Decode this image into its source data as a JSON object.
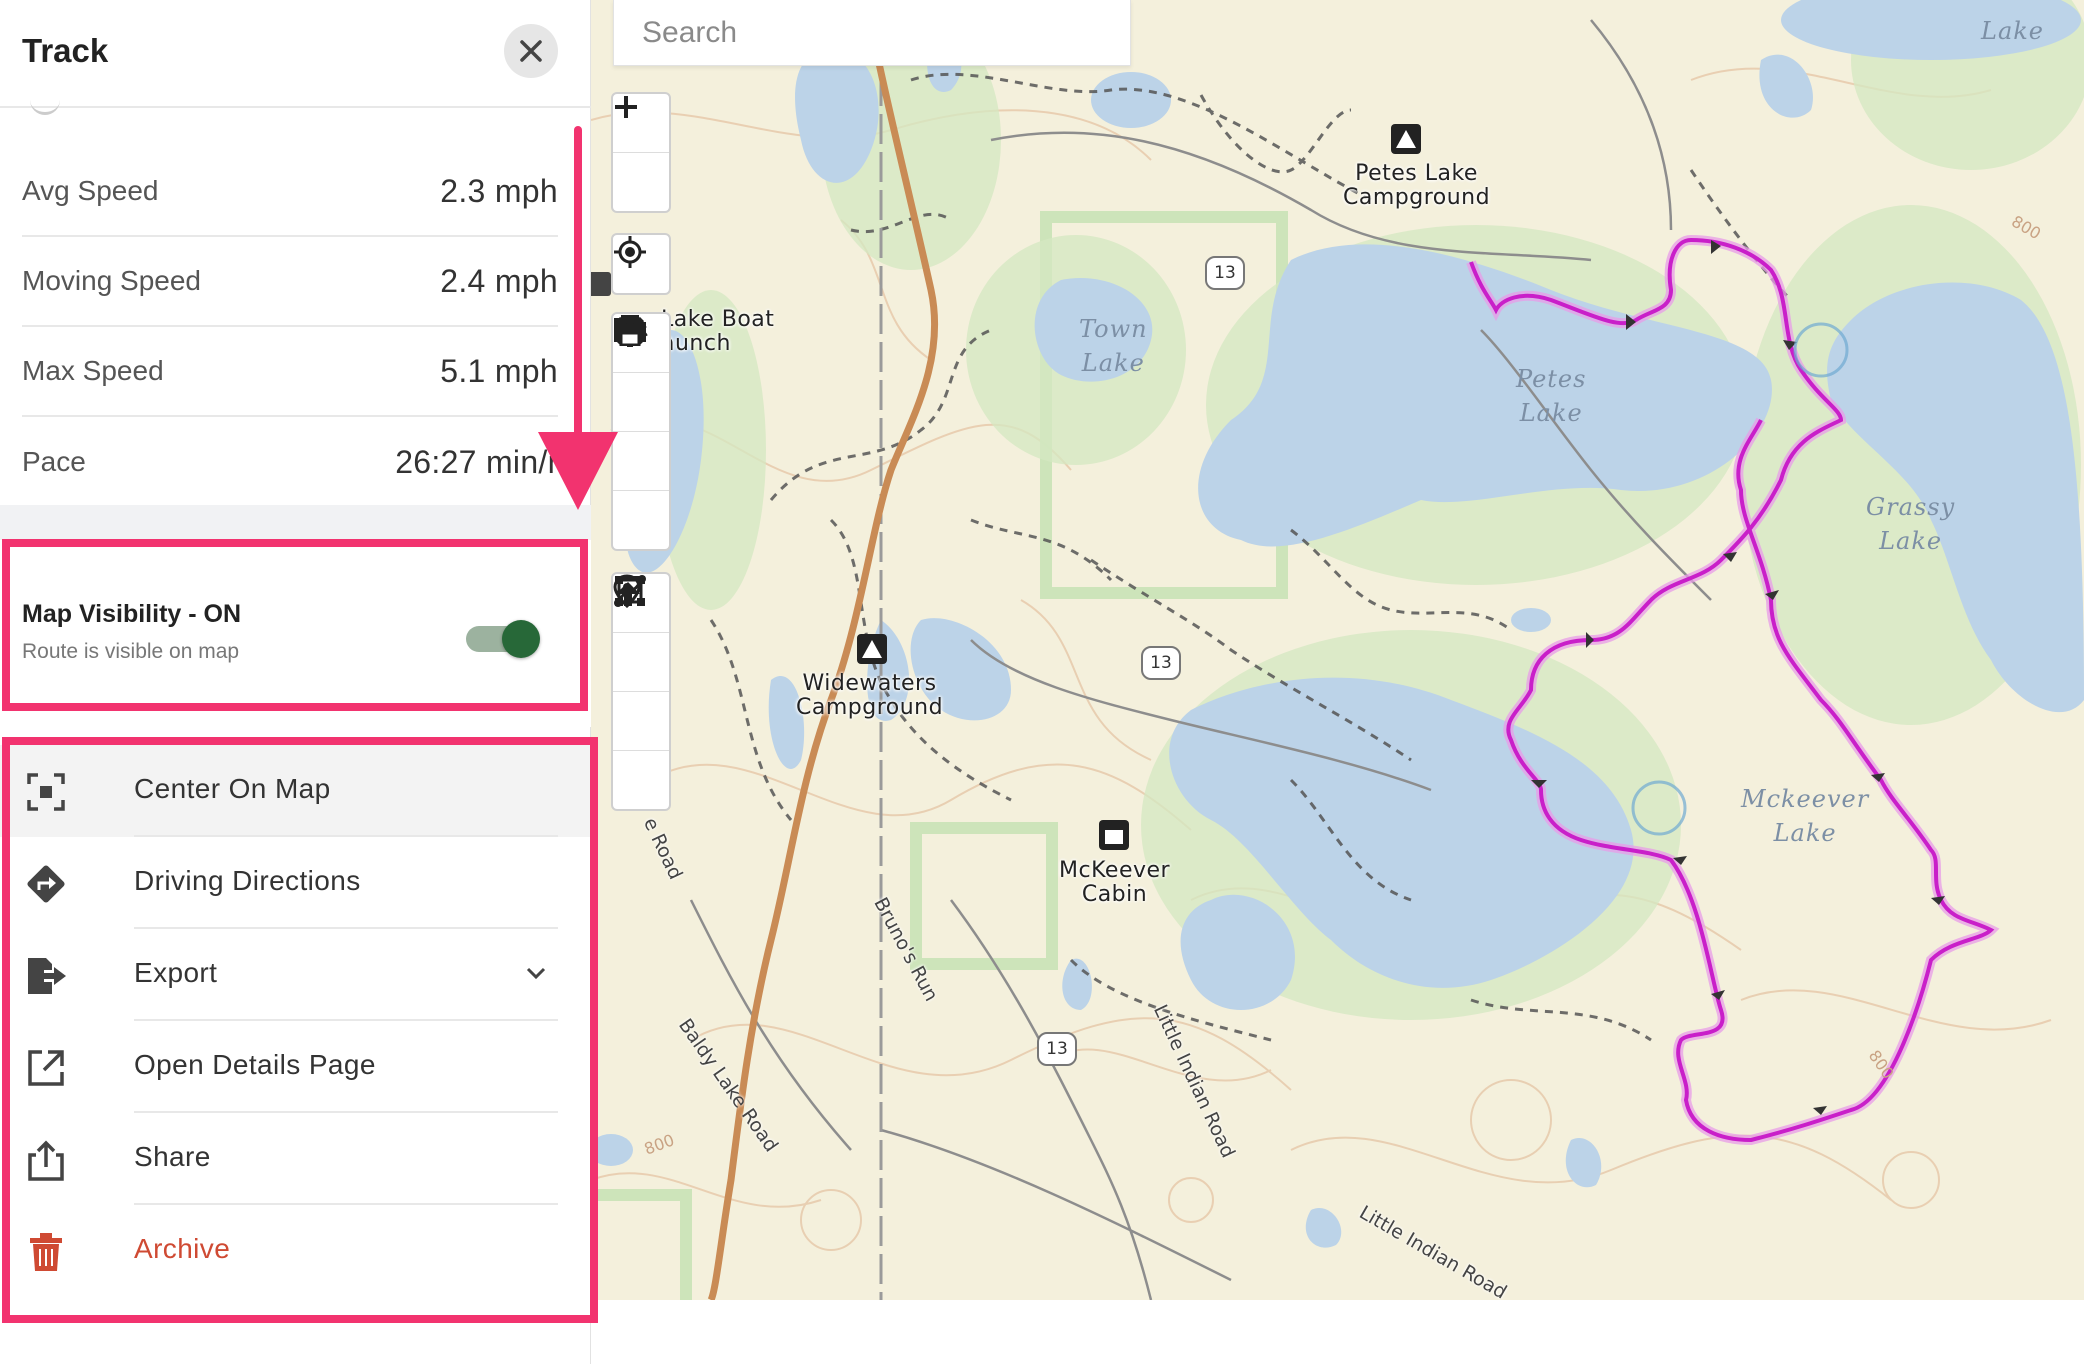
{
  "panel": {
    "title": "Track",
    "close_icon": "close-icon",
    "stats": [
      {
        "label": "Avg Speed",
        "value": "2.3 mph"
      },
      {
        "label": "Moving Speed",
        "value": "2.4 mph"
      },
      {
        "label": "Max Speed",
        "value": "5.1 mph"
      },
      {
        "label": "Pace",
        "value": "26:27 min/mi"
      }
    ],
    "visibility": {
      "title": "Map Visibility - ON",
      "subtitle": "Route is visible on map",
      "enabled": true
    },
    "actions": [
      {
        "label": "Center On Map",
        "icon": "center-focus-icon"
      },
      {
        "label": "Driving Directions",
        "icon": "directions-icon"
      },
      {
        "label": "Export",
        "icon": "export-icon"
      },
      {
        "label": "Open Details Page",
        "icon": "external-link-icon"
      },
      {
        "label": "Share",
        "icon": "share-icon"
      },
      {
        "label": "Archive",
        "icon": "trash-icon"
      }
    ]
  },
  "map": {
    "search_placeholder": "Search",
    "controls": [
      "zoom-in-icon",
      "zoom-out-icon",
      "locate-icon",
      "layers-icon",
      "folder-icon",
      "settings-icon",
      "print-icon",
      "marker-icon",
      "route-icon",
      "area-icon",
      "upload-icon"
    ],
    "labels": {
      "petes_campground": "Petes Lake\nCampground",
      "widewaters_campground": "Widewaters\nCampground",
      "mckeever_cabin": "McKeever\nCabin",
      "boat_launch": "Lake Boat\naunch",
      "town_lake": "Town\nLake",
      "petes_lake": "Petes\nLake",
      "grassy_lake": "Grassy\nLake",
      "mckeever_lake": "Mckeever\nLake",
      "herman_lake": "Lake",
      "brunos_run": "Bruno's Run",
      "baldy_lake_road": "Baldy Lake Road",
      "little_indian_road_1": "Little Indian Road",
      "little_indian_road_2": "Little Indian Road",
      "road_frag": "e Road",
      "hwy_13": "13",
      "contour_800": "800"
    }
  },
  "colors": {
    "highlight": "#f2336f",
    "toggle_on": "#276838",
    "archive": "#cf4a33",
    "route": "#c91fc9",
    "water": "#bcd3e8",
    "land": "#f4f0dc"
  }
}
